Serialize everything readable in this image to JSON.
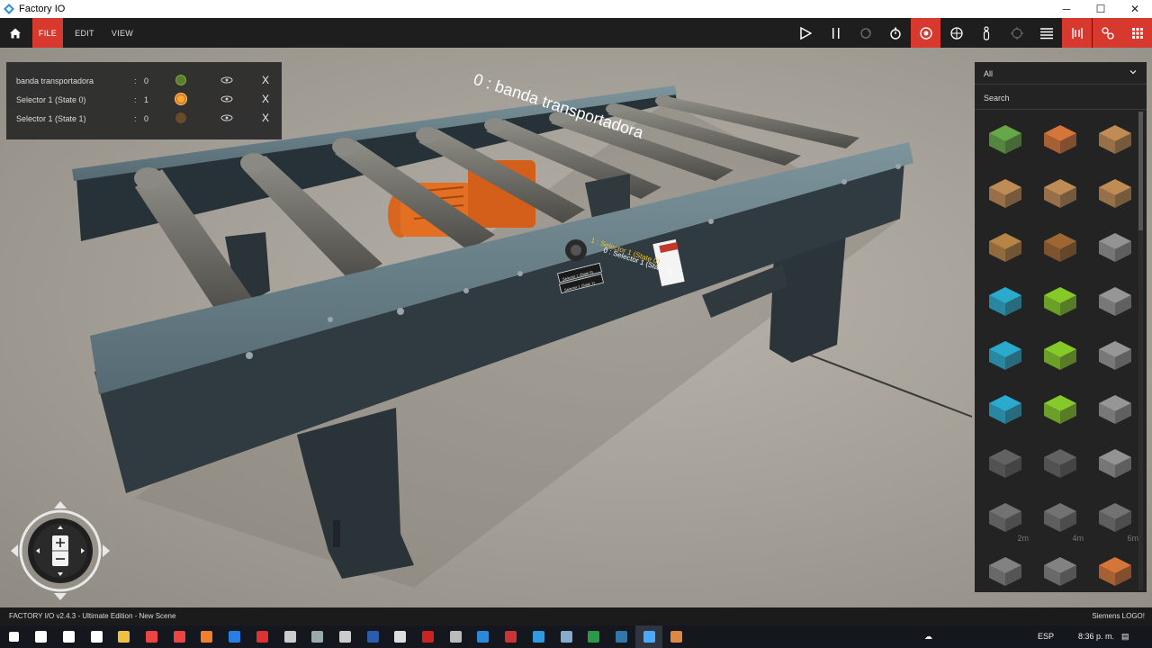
{
  "window": {
    "title": "Factory IO",
    "minimize": "─",
    "maximize": "☐",
    "close": "✕"
  },
  "toolbar": {
    "menus": [
      {
        "label": "FILE"
      },
      {
        "label": "EDIT"
      },
      {
        "label": "VIEW"
      }
    ],
    "active_menu": "FILE",
    "icons": [
      "home-icon",
      "play-icon",
      "pause-icon",
      "reset-icon",
      "stopwatch-icon",
      "camera-orbit-icon",
      "fly-camera-icon",
      "first-person-icon",
      "snap-icon",
      "tags-list-icon",
      "sensors-icon",
      "drivers-icon",
      "catalog-grid-icon"
    ],
    "accent": "#d7392f"
  },
  "tags": [
    {
      "name": "banda transportadora",
      "value": "0",
      "indicator": "green"
    },
    {
      "name": "Selector 1 (State 0)",
      "value": "1",
      "indicator": "orange-active"
    },
    {
      "name": "Selector 1 (State 1)",
      "value": "0",
      "indicator": "orange-dim"
    }
  ],
  "tag_colon": ":",
  "tag_eye_icon": "◦◦",
  "tag_close": "X",
  "scene_labels": {
    "conveyor": "0 : banda transportadora",
    "selector_state0": "1 : Selector 1 (State 0)",
    "selector_state1": "0 : Selector 1 (State 1)",
    "plate_line1": "Selector 1 (State 0)",
    "plate_line2": "Selector 1 (State 1)"
  },
  "catalog": {
    "filter": "All",
    "search_placeholder": "Search",
    "items": [
      {
        "name": "emitter-icon",
        "color": "#6ab04c"
      },
      {
        "name": "remover-icon",
        "color": "#e07a3b"
      },
      {
        "name": "small-box-icon",
        "color": "#c9925a"
      },
      {
        "name": "medium-box-icon",
        "color": "#c9925a"
      },
      {
        "name": "box-icon",
        "color": "#c9925a"
      },
      {
        "name": "large-box-icon",
        "color": "#c9925a"
      },
      {
        "name": "pallet-icon",
        "color": "#c08a4a"
      },
      {
        "name": "pallet-dark-icon",
        "color": "#a46a34"
      },
      {
        "name": "stackable-box-icon",
        "color": "#9a9a9a"
      },
      {
        "name": "blue-raw-material-icon",
        "color": "#2bb3d8"
      },
      {
        "name": "green-raw-material-icon",
        "color": "#8bd42a"
      },
      {
        "name": "metal-raw-material-icon",
        "color": "#9d9d9d"
      },
      {
        "name": "blue-product-base-icon",
        "color": "#2bb3d8"
      },
      {
        "name": "green-product-base-icon",
        "color": "#8bd42a"
      },
      {
        "name": "metal-product-base-icon",
        "color": "#9d9d9d"
      },
      {
        "name": "blue-product-lid-icon",
        "color": "#2bb3d8"
      },
      {
        "name": "green-product-lid-icon",
        "color": "#8bd42a"
      },
      {
        "name": "metal-product-lid-icon",
        "color": "#9d9d9d"
      },
      {
        "name": "belt-conveyor-icon",
        "color": "#666666"
      },
      {
        "name": "roller-conveyor-motor-icon",
        "color": "#666666"
      },
      {
        "name": "plate-icon",
        "color": "#9a9a9a"
      },
      {
        "name": "roller-conveyor-2m-icon",
        "color": "#777777",
        "len": "2m"
      },
      {
        "name": "roller-conveyor-4m-icon",
        "color": "#777777",
        "len": "4m"
      },
      {
        "name": "roller-conveyor-6m-icon",
        "color": "#777777",
        "len": "6m"
      },
      {
        "name": "chain-transfer-icon",
        "color": "#888888"
      },
      {
        "name": "curved-roller-conveyor-icon",
        "color": "#888888"
      },
      {
        "name": "belt-conveyor-orange-icon",
        "color": "#e07a3b"
      }
    ]
  },
  "status": {
    "left": "FACTORY I/O v2.4.3 - Ultimate Edition - New Scene",
    "right": "Siemens LOGO!"
  },
  "taskbar": {
    "apps": [
      "start-icon",
      "search-icon",
      "cortana-icon",
      "task-view-icon",
      "file-explorer-icon",
      "chrome-icon",
      "app-red-icon",
      "app-orange-icon",
      "teamviewer-icon",
      "acrobat-icon",
      "app-settings-icon",
      "app-tool-icon",
      "app-grid-icon",
      "word-icon",
      "app-files-icon",
      "app-red2-icon",
      "app-bird-icon",
      "vscode-icon",
      "app-red3-icon",
      "app-blue-icon",
      "logo-soft-icon",
      "excel-green-icon",
      "app-blue2-icon",
      "factory-io-icon",
      "app-orange2-icon"
    ],
    "language": "ESP",
    "time": "8:36 p. m."
  }
}
